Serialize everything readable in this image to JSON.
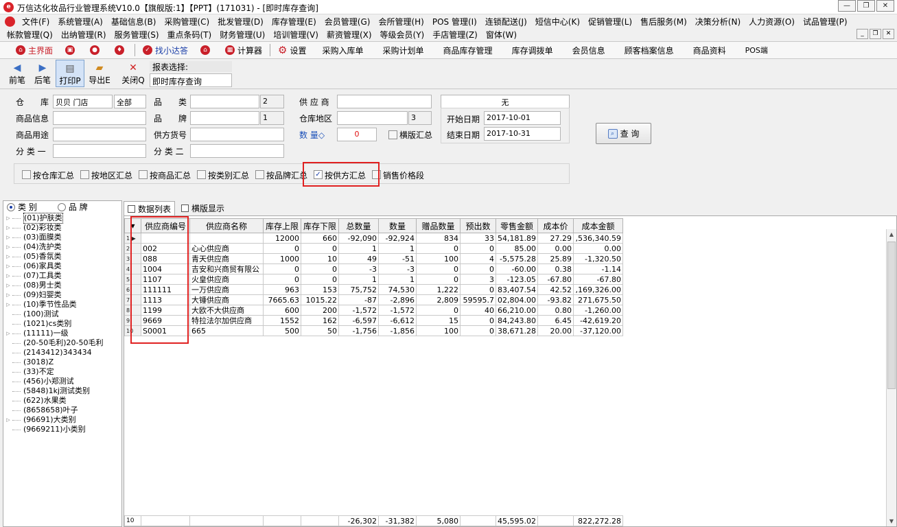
{
  "window": {
    "title": "万信达化妆品行业管理系统V10.0【旗舰版:1】【PPT】(171031) - [即时库存查询]",
    "logo_text": "e"
  },
  "menu": {
    "row1": [
      "文件(F)",
      "系统管理(A)",
      "基础信息(B)",
      "采购管理(C)",
      "批发管理(D)",
      "库存管理(E)",
      "会员管理(G)",
      "会所管理(H)",
      "POS 管理(I)",
      "连锁配送(J)",
      "短信中心(K)",
      "促销管理(L)",
      "售后服务(M)",
      "决策分析(N)",
      "人力资源(O)",
      "试品管理(P)"
    ],
    "row2": [
      "帐款管理(Q)",
      "出纳管理(R)",
      "服务管理(S)",
      "重点条码(T)",
      "财务管理(U)",
      "培训管理(V)",
      "薪资管理(X)",
      "等级会员(Y)",
      "手店管理(Z)",
      "窗体(W)"
    ]
  },
  "quickbar": {
    "home": "主界面",
    "find": "找小达答",
    "calculator": "计算器",
    "settings": "设置",
    "links": [
      "采购入库单",
      "采购计划单",
      "商品库存管理",
      "库存调拨单",
      "会员信息",
      "顾客档案信息",
      "商品资料",
      "POS端"
    ]
  },
  "actions": {
    "prev": "前笔",
    "next": "后笔",
    "print": "打印P",
    "export": "导出E",
    "close": "关闭Q",
    "report_label": "报表选择:",
    "report_value": "即时库存查询"
  },
  "filters": {
    "warehouse_label": "仓　　库",
    "warehouse_value": "贝贝 门店",
    "warehouse_scope": "全部",
    "goods_info_label": "商品信息",
    "goods_usage_label": "商品用途",
    "class1_label": "分 类 一",
    "category_label": "品　　类",
    "category_count": "2",
    "brand_label": "品　　牌",
    "brand_count": "1",
    "supplier_code_label": "供方货号",
    "class2_label": "分 类 二",
    "supplier_label": "供 应 商",
    "region_label": "仓库地区",
    "region_count": "3",
    "qty_label": "数 量◇",
    "qty_value": "0",
    "horizontal_label": "横版汇总",
    "none_value": "无",
    "start_date_label": "开始日期",
    "start_date": "2017-10-01",
    "end_date_label": "结束日期",
    "end_date": "2017-10-31",
    "query_button": "查 询",
    "group_by": [
      {
        "label": "按仓库汇总",
        "checked": false
      },
      {
        "label": "按地区汇总",
        "checked": false
      },
      {
        "label": "按商品汇总",
        "checked": false
      },
      {
        "label": "按类别汇总",
        "checked": false
      },
      {
        "label": "按品牌汇总",
        "checked": false
      },
      {
        "label": "按供方汇总",
        "checked": true
      },
      {
        "label": "销售价格段",
        "checked": false
      }
    ]
  },
  "tree": {
    "radio_category": "类 别",
    "radio_brand": "品 牌",
    "items": [
      {
        "label": "(01)护肤类",
        "expandable": true,
        "selected": true
      },
      {
        "label": "(02)彩妆类",
        "expandable": true
      },
      {
        "label": "(03)面膜类",
        "expandable": true
      },
      {
        "label": "(04)洗护类",
        "expandable": true
      },
      {
        "label": "(05)香氛类",
        "expandable": true
      },
      {
        "label": "(06)家具类",
        "expandable": true
      },
      {
        "label": "(07)工具类",
        "expandable": true
      },
      {
        "label": "(08)男士类",
        "expandable": true
      },
      {
        "label": "(09)妇婴类",
        "expandable": true
      },
      {
        "label": "(10)季节性品类",
        "expandable": true
      },
      {
        "label": "(100)测试",
        "expandable": false
      },
      {
        "label": "(1021)cs类别",
        "expandable": false
      },
      {
        "label": "(11111)一级",
        "expandable": true
      },
      {
        "label": "(20-50毛利)20-50毛利",
        "expandable": false
      },
      {
        "label": "(2143412)343434",
        "expandable": false
      },
      {
        "label": "(3018)Z",
        "expandable": false
      },
      {
        "label": "(33)不定",
        "expandable": false
      },
      {
        "label": "(456)小郑测试",
        "expandable": false
      },
      {
        "label": "(5848)1kj测试类别",
        "expandable": false
      },
      {
        "label": "(622)水果类",
        "expandable": false
      },
      {
        "label": "(8658658)叶子",
        "expandable": false
      },
      {
        "label": "(96691)大类别",
        "expandable": true
      },
      {
        "label": "(9669211)小类别",
        "expandable": false
      }
    ]
  },
  "tabs": [
    "数据列表",
    "横版显示"
  ],
  "grid": {
    "columns": [
      "供应商编号",
      "供应商名称",
      "库存上限",
      "库存下限",
      "总数量",
      "数量",
      "赠品数量",
      "预出数",
      "零售金额",
      "成本价",
      "成本金额"
    ],
    "rows": [
      [
        "",
        "",
        "12000",
        "660",
        "-92,090",
        "-92,924",
        "834",
        "33",
        "54,181.89",
        "27.29",
        ",536,340.59"
      ],
      [
        "002",
        "心心供应商",
        "0",
        "0",
        "1",
        "1",
        "0",
        "0",
        "85.00",
        "0.00",
        "0.00"
      ],
      [
        "088",
        "青天供应商",
        "1000",
        "10",
        "49",
        "-51",
        "100",
        "4",
        "-5,575.28",
        "25.89",
        "-1,320.50"
      ],
      [
        "1004",
        "吉安和兴商贸有限公",
        "0",
        "0",
        "-3",
        "-3",
        "0",
        "0",
        "-60.00",
        "0.38",
        "-1.14"
      ],
      [
        "1107",
        "火皇供应商",
        "0",
        "0",
        "1",
        "1",
        "0",
        "3",
        "-123.05",
        "-67.80",
        "-67.80"
      ],
      [
        "111111",
        "一万供应商",
        "963",
        "153",
        "75,752",
        "74,530",
        "1,222",
        "0",
        "83,407.54",
        "42.52",
        ",169,326.00"
      ],
      [
        "1113",
        "大锤供应商",
        "7665.63",
        "1015.22",
        "-87",
        "-2,896",
        "2,809",
        "59595.7",
        "02,804.00",
        "-93.82",
        "271,675.50"
      ],
      [
        "1199",
        "大欧不大供应商",
        "600",
        "200",
        "-1,572",
        "-1,572",
        "0",
        "40",
        "66,210.00",
        "0.80",
        "-1,260.00"
      ],
      [
        "9669",
        "特拉法尔加供应商",
        "1552",
        "162",
        "-6,597",
        "-6,612",
        "15",
        "0",
        "84,243.80",
        "6.45",
        "-42,619.20"
      ],
      [
        "S0001",
        "665",
        "500",
        "50",
        "-1,756",
        "-1,856",
        "100",
        "0",
        "38,671.28",
        "20.00",
        "-37,120.00"
      ]
    ],
    "totals": {
      "count": "10",
      "total_qty": "-26,302",
      "qty": "-31,382",
      "gift_qty": "5,080",
      "retail_amount": "45,595.02",
      "cost_amount": "822,272.28"
    }
  }
}
